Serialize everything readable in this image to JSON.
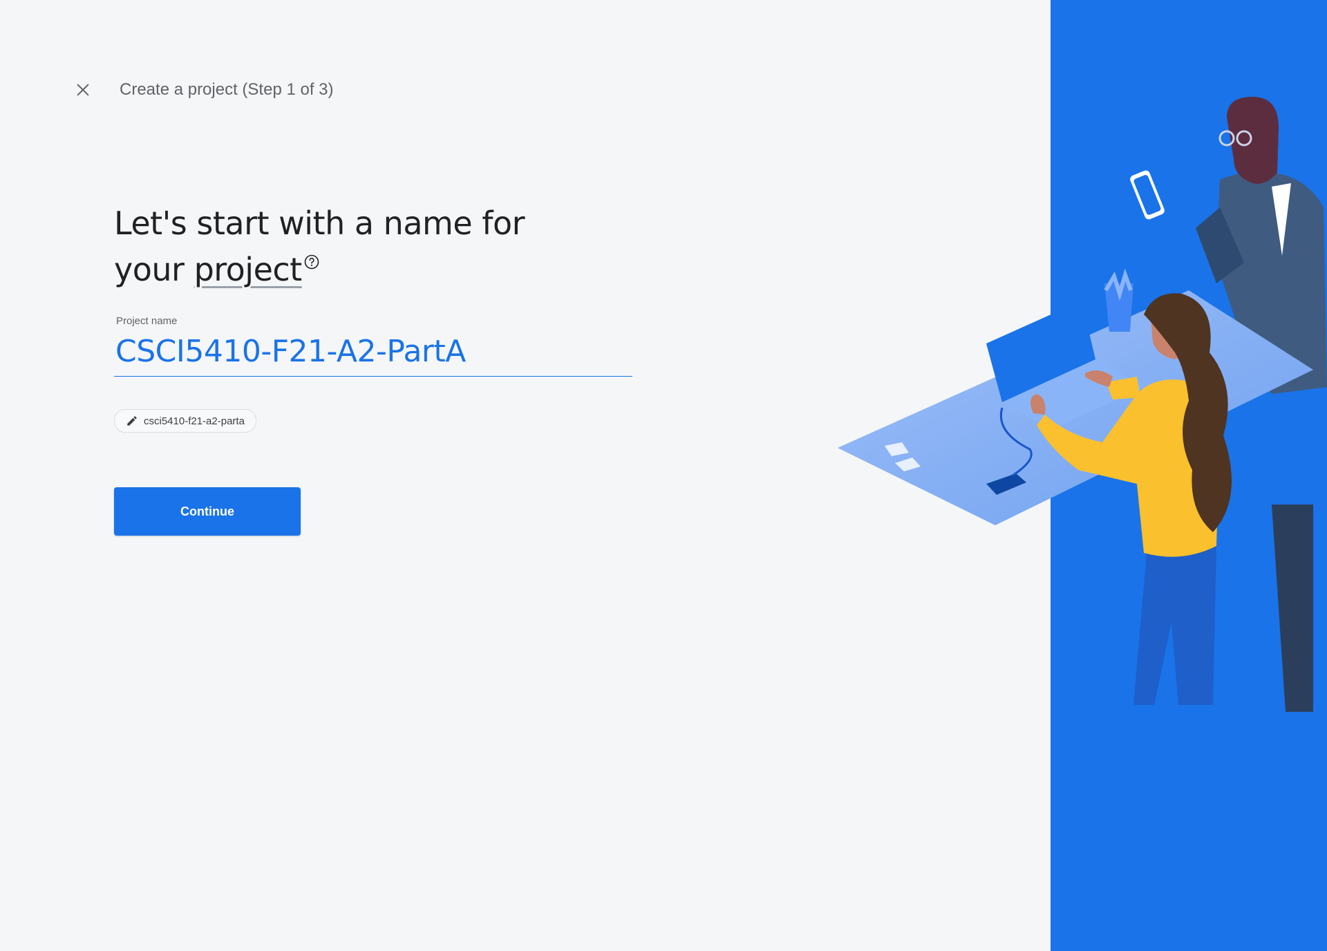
{
  "header": {
    "step_title": "Create a project (Step 1 of 3)"
  },
  "main": {
    "heading_part1": "Let's start with a name for",
    "heading_part2": "your",
    "heading_link": "project",
    "field_label": "Project name",
    "field_value": "CSCI5410-F21-A2-PartA",
    "project_id_chip": "csci5410-f21-a2-parta",
    "continue_label": "Continue"
  },
  "icons": {
    "close": "close-icon",
    "help": "help-icon",
    "edit": "pencil-icon"
  },
  "colors": {
    "accent": "#1a73e8",
    "background": "#f5f6f7",
    "illustration_panel": "#1a73e8"
  }
}
